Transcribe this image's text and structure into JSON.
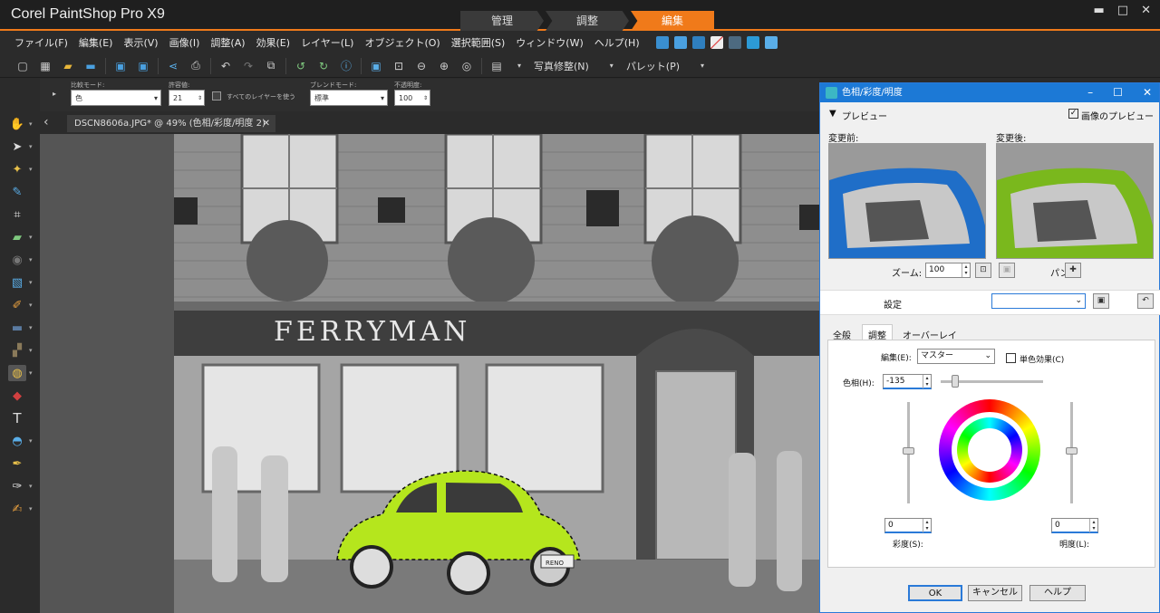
{
  "app": {
    "title": "Corel PaintShop Pro X9"
  },
  "workspace_tabs": [
    "管理",
    "調整",
    "編集"
  ],
  "window_controls": {
    "minimize": "▬",
    "restore": "□",
    "close": "✕"
  },
  "menu": [
    "ファイル(F)",
    "編集(E)",
    "表示(V)",
    "画像(I)",
    "調整(A)",
    "効果(E)",
    "レイヤー(L)",
    "オブジェクト(O)",
    "選択範囲(S)",
    "ウィンドウ(W)",
    "ヘルプ(H)"
  ],
  "toolbar": {
    "photo_fix": "写真修整(N)",
    "palette": "パレット(P)"
  },
  "options": {
    "compare_mode_label": "比較モード:",
    "compare_mode_value": "色",
    "tolerance_label": "許容値:",
    "tolerance_value": "21",
    "all_layers_label": "すべてのレイヤーを使う",
    "blend_mode_label": "ブレンドモード:",
    "blend_mode_value": "標準",
    "opacity_label": "不透明度:",
    "opacity_value": "100"
  },
  "document": {
    "tab_label": "DSCN8606a.JPG* @ 49% (色相/彩度/明度 2)"
  },
  "photo_text": {
    "sign": "FERRYMAN",
    "plate": "RENO"
  },
  "dialog": {
    "title": "色相/彩度/明度",
    "preview_label": "プレビュー",
    "image_preview_label": "画像のプレビュー",
    "before_label": "変更前:",
    "after_label": "変更後:",
    "zoom_label": "ズーム:",
    "zoom_value": "100",
    "pan_label": "パン:",
    "settings_label": "設定",
    "tabs": [
      "全般",
      "調整",
      "オーバーレイ"
    ],
    "edit_label": "編集(E):",
    "edit_value": "マスター",
    "colorize_label": "単色効果(C)",
    "hue_label": "色相(H):",
    "hue_value": "-135",
    "saturation_label": "彩度(S):",
    "saturation_value": "0",
    "lightness_label": "明度(L):",
    "lightness_value": "0",
    "ok": "OK",
    "cancel": "キャンセル",
    "help": "ヘルプ"
  },
  "colors": {
    "accent": "#f07a1a",
    "dialog_title": "#1c79d6",
    "car": "#b5e61d"
  }
}
